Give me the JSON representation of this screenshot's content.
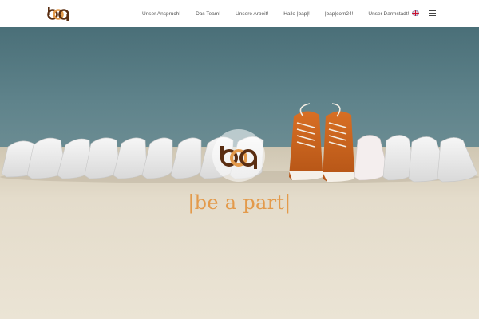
{
  "header": {
    "logo_text": "bqp",
    "nav": [
      {
        "label": "Unser Anspruch!"
      },
      {
        "label": "Das Team!"
      },
      {
        "label": "Unsere Arbeit!"
      },
      {
        "label": "Hallo |bap|!"
      },
      {
        "label": "|bap|com24!"
      },
      {
        "label": "Unser Darmstadt!"
      }
    ],
    "language_icon": "uk-flag-icon",
    "menu_icon": "hamburger-menu-icon"
  },
  "hero": {
    "tagline": "|be a part|",
    "logo_icon": "bap-logo-icon",
    "colors": {
      "brand_brown": "#5a2e12",
      "brand_orange": "#e39a4b"
    }
  }
}
